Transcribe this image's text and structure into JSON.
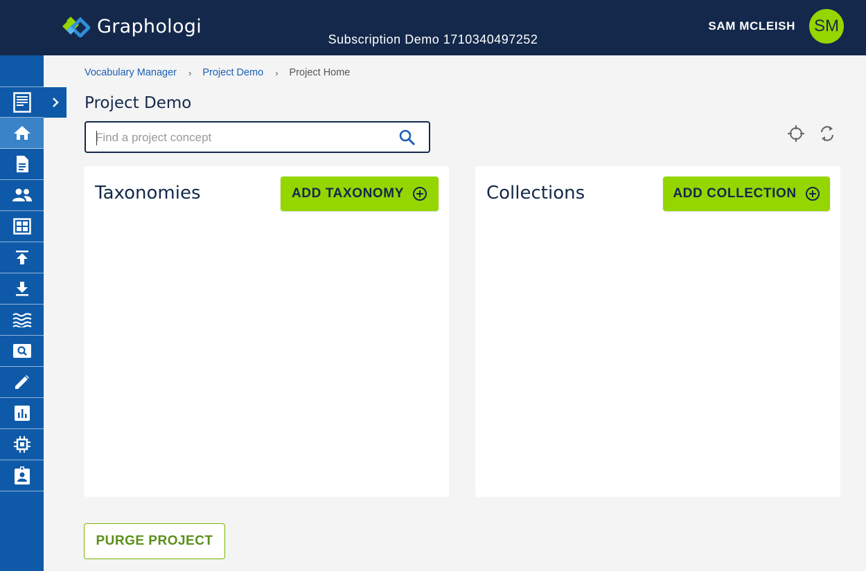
{
  "app": {
    "name": "Graphologi",
    "workspace": "Subscription Demo 1710340497252"
  },
  "user": {
    "name": "SAM MCLEISH",
    "initials": "SM"
  },
  "sidebar": {
    "items": [
      {
        "icon": "dashboard-page-icon"
      },
      {
        "icon": "home-icon",
        "active": true
      },
      {
        "icon": "document-icon"
      },
      {
        "icon": "people-icon"
      },
      {
        "icon": "layout-grid-icon"
      },
      {
        "icon": "upload-icon"
      },
      {
        "icon": "download-icon"
      },
      {
        "icon": "waves-icon"
      },
      {
        "icon": "search-box-icon"
      },
      {
        "icon": "pencil-icon"
      },
      {
        "icon": "chart-icon"
      },
      {
        "icon": "chip-icon"
      },
      {
        "icon": "badge-icon"
      }
    ]
  },
  "breadcrumb": {
    "items": [
      "Vocabulary Manager",
      "Project Demo"
    ],
    "current": "Project Home"
  },
  "page": {
    "title": "Project Demo"
  },
  "search": {
    "placeholder": "Find a project concept"
  },
  "taxonomies": {
    "title": "Taxonomies",
    "add_label": "ADD TAXONOMY"
  },
  "collections": {
    "title": "Collections",
    "add_label": "ADD COLLECTION"
  },
  "purge": {
    "label": "PURGE PROJECT"
  },
  "colors": {
    "header_bg": "#14284b",
    "sidebar_bg": "#0f5aa8",
    "sidebar_active": "#3a83c8",
    "accent_green": "#95d500",
    "link_blue": "#1a5fb4"
  }
}
